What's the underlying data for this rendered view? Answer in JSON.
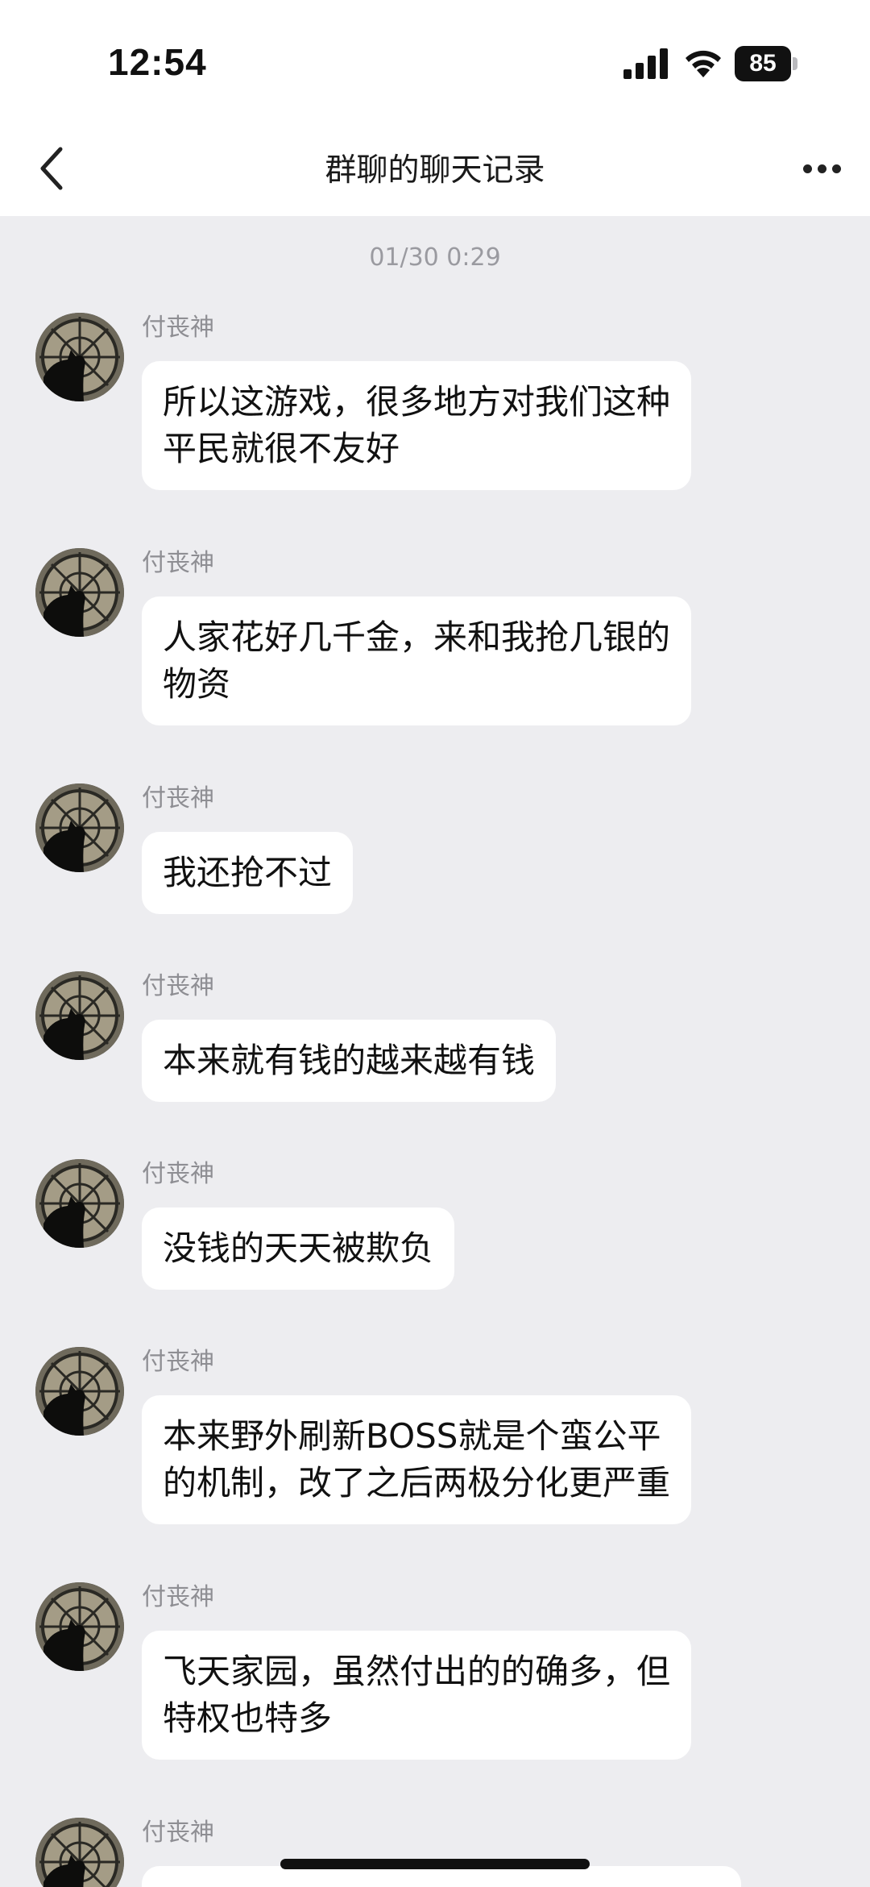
{
  "status": {
    "time": "12:54",
    "battery": "85",
    "icons": [
      "signal-icon",
      "wifi-icon",
      "battery-icon"
    ]
  },
  "header": {
    "title": "群聊的聊天记录",
    "back_icon": "chevron-left-icon",
    "more_icon": "more-dots-icon"
  },
  "chat": {
    "timestamp": "01/30 0:29",
    "messages": [
      {
        "sender": "付丧神",
        "text": "所以这游戏，很多地方对我们这种\n平民就很不友好"
      },
      {
        "sender": "付丧神",
        "text": "人家花好几千金，来和我抢几银的\n物资"
      },
      {
        "sender": "付丧神",
        "text": "我还抢不过"
      },
      {
        "sender": "付丧神",
        "text": "本来就有钱的越来越有钱"
      },
      {
        "sender": "付丧神",
        "text": "没钱的天天被欺负"
      },
      {
        "sender": "付丧神",
        "text": "本来野外刷新BOSS就是个蛮公平\n的机制，改了之后两极分化更严重"
      },
      {
        "sender": "付丧神",
        "text": "飞天家园，虽然付出的的确多，但\n特权也特多"
      },
      {
        "sender": "付丧神",
        "text": ""
      }
    ]
  },
  "colors": {
    "background": "#ededf0",
    "bubble": "#ffffff",
    "sender": "#8e8e93"
  }
}
